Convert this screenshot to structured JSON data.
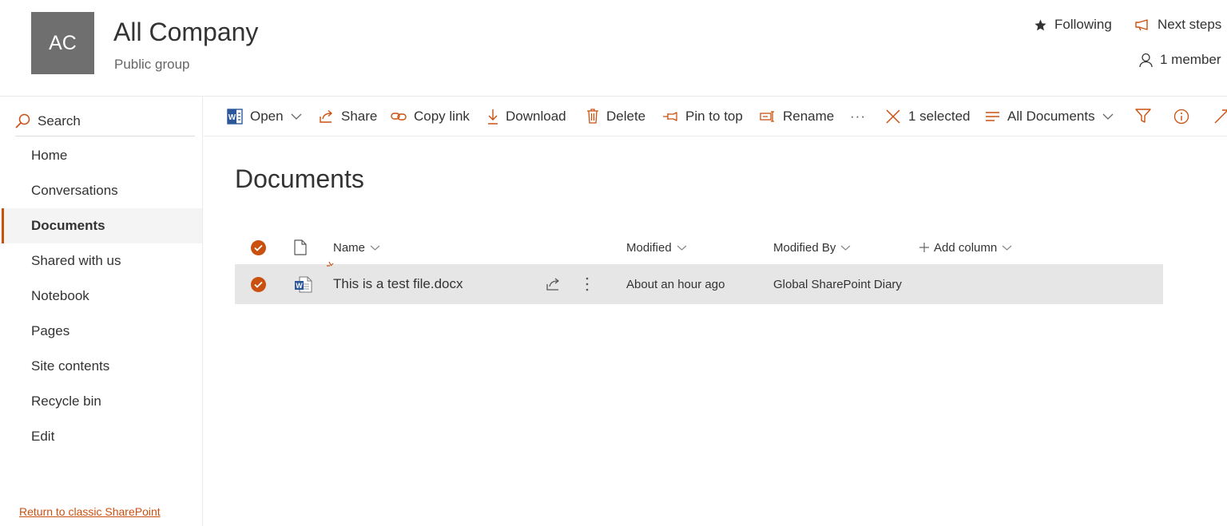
{
  "site": {
    "logo_initials": "AC",
    "title": "All Company",
    "subtitle": "Public group",
    "following_label": "Following",
    "next_steps_label": "Next steps",
    "members_label": "1 member"
  },
  "search": {
    "placeholder": "Search"
  },
  "nav": {
    "items": [
      {
        "label": "Home",
        "selected": false
      },
      {
        "label": "Conversations",
        "selected": false
      },
      {
        "label": "Documents",
        "selected": true
      },
      {
        "label": "Shared with us",
        "selected": false
      },
      {
        "label": "Notebook",
        "selected": false
      },
      {
        "label": "Pages",
        "selected": false
      },
      {
        "label": "Site contents",
        "selected": false
      },
      {
        "label": "Recycle bin",
        "selected": false
      },
      {
        "label": "Edit",
        "selected": false
      }
    ],
    "classic_link": "Return to classic SharePoint"
  },
  "commands": {
    "open": "Open",
    "share": "Share",
    "copy_link": "Copy link",
    "download": "Download",
    "delete": "Delete",
    "pin_to_top": "Pin to top",
    "rename": "Rename",
    "more": "···",
    "selected_count": "1 selected",
    "view": "All Documents"
  },
  "library": {
    "title": "Documents",
    "columns": {
      "name": "Name",
      "modified": "Modified",
      "modified_by": "Modified By",
      "add_column": "Add column"
    },
    "rows": [
      {
        "name": "This is a test file.docx",
        "modified": "About an hour ago",
        "modified_by": "Global SharePoint Diary",
        "selected": true,
        "file_type": "word-document"
      }
    ]
  },
  "colors": {
    "accent": "#ca5010",
    "logo_bg": "#6f6f6f",
    "selected_row_bg": "#e6e6e6",
    "word_blue": "#2b579a"
  }
}
